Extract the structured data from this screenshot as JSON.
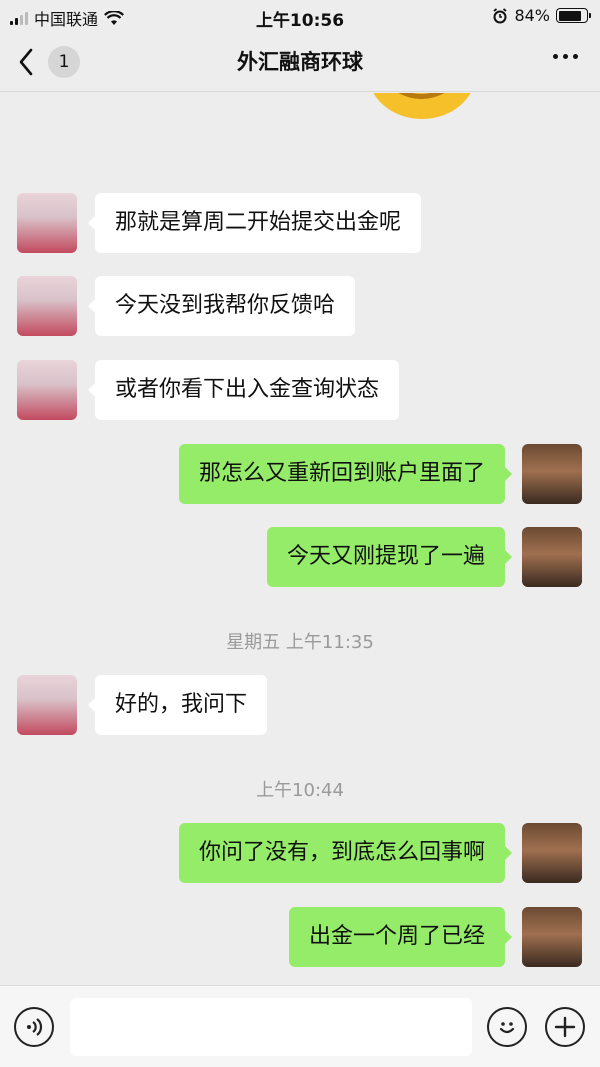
{
  "status_bar": {
    "carrier": "中国联通",
    "time": "上午10:56",
    "battery": "84%",
    "battery_level": 0.84
  },
  "nav": {
    "back_badge": "1",
    "title": "外汇融商环球"
  },
  "messages": [
    {
      "side": "in",
      "text": "那就是算周二开始提交出金呢"
    },
    {
      "side": "in",
      "text": "今天没到我帮你反馈哈"
    },
    {
      "side": "in",
      "text": "或者你看下出入金查询状态"
    },
    {
      "side": "out",
      "text": "那怎么又重新回到账户里面了"
    },
    {
      "side": "out",
      "text": "今天又刚提现了一遍"
    },
    {
      "side": "time",
      "text": "星期五 上午11:35"
    },
    {
      "side": "in",
      "text": "好的，我问下"
    },
    {
      "side": "time",
      "text": "上午10:44"
    },
    {
      "side": "out",
      "text": "你问了没有，到底怎么回事啊"
    },
    {
      "side": "out",
      "text": "出金一个周了已经"
    }
  ],
  "colors": {
    "background": "#ededed",
    "incoming_bubble": "#ffffff",
    "outgoing_bubble": "#95ec69"
  }
}
